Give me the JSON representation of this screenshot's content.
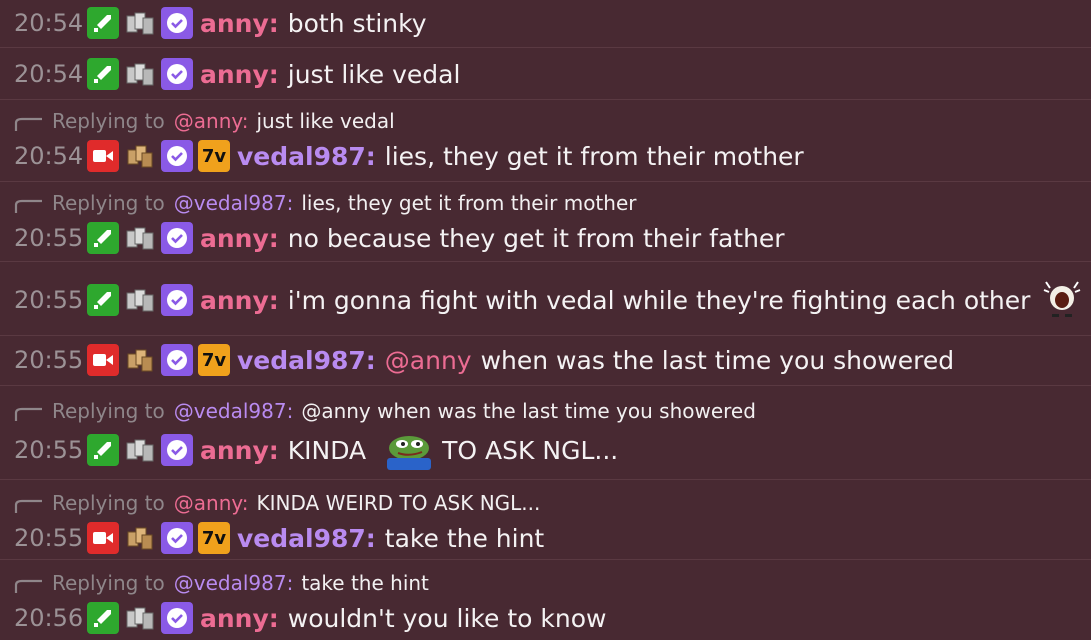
{
  "messages": [
    {
      "time": "20:54",
      "user": "anny",
      "text": "both stinky"
    },
    {
      "time": "20:54",
      "user": "anny",
      "text": "just like vedal"
    },
    {
      "reply": {
        "mention": "@anny:",
        "text": "just like vedal",
        "to": "anny"
      },
      "time": "20:54",
      "user": "vedal987",
      "text": "lies, they get it from their mother"
    },
    {
      "reply": {
        "mention": "@vedal987:",
        "text": "lies, they get it from their mother",
        "to": "vedal"
      },
      "time": "20:55",
      "user": "anny",
      "text": "no because they get it from their father"
    },
    {
      "time": "20:55",
      "user": "anny",
      "text": "i'm gonna fight with vedal while they're fighting each other"
    },
    {
      "time": "20:55",
      "user": "vedal987",
      "mention": "@anny",
      "text": "when was the last time you showered"
    },
    {
      "reply": {
        "mention": "@vedal987:",
        "text": "@anny when was the last time you showered",
        "to": "vedal"
      },
      "time": "20:55",
      "user": "anny",
      "text_before": "KINDA",
      "text_after": "TO ASK NGL..."
    },
    {
      "reply": {
        "mention": "@anny:",
        "text": "KINDA WEIRD TO ASK NGL...",
        "to": "anny"
      },
      "time": "20:55",
      "user": "vedal987",
      "text": "take the hint"
    },
    {
      "reply": {
        "mention": "@vedal987:",
        "text": "take the hint",
        "to": "vedal"
      },
      "time": "20:56",
      "user": "anny",
      "text": "wouldn't you like to know"
    }
  ],
  "labels": {
    "replying_to": "Replying to",
    "anny_name": "anny:",
    "vedal_name": "vedal987:"
  },
  "badge_text": {
    "seventv": "7v"
  },
  "colors": {
    "background": "#482932",
    "anny": "#ec6c93",
    "vedal": "#b98bf0",
    "timestamp": "#9c9296",
    "moderator": "#2ea82e",
    "verified": "#8a5ae6",
    "broadcaster": "#e02b2b",
    "seventv": "#f0a11c"
  },
  "icons": {
    "moderator": "sword-icon",
    "bits": "bits-icon",
    "verified": "verified-check-icon",
    "broadcaster": "camera-icon",
    "subscriber": "subscriber-icon",
    "seventv": "7tv-icon",
    "reply": "reply-arrow-icon",
    "emote1": "scared-emote",
    "emote2": "pepe-emote"
  }
}
